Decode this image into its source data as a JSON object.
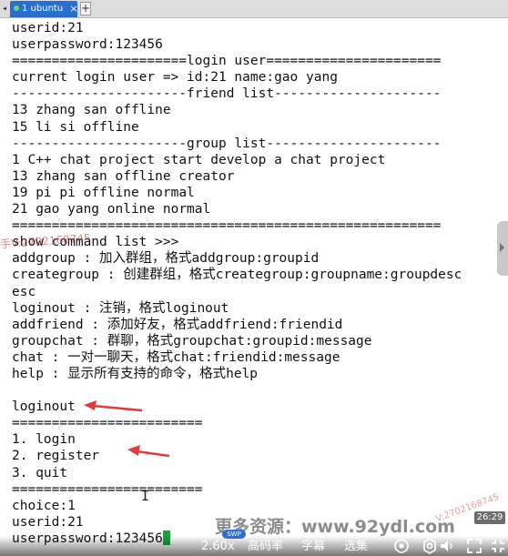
{
  "tabbar": {
    "tab_label": "1 ubuntu",
    "close_glyph": "×",
    "add_glyph": "+"
  },
  "terminal": {
    "lines": [
      "userid:21",
      "userpassword:123456",
      "======================login user======================",
      "current login user => id:21 name:gao yang",
      "----------------------friend list---------------------",
      "13 zhang san offline",
      "15 li si offline",
      "----------------------group list----------------------",
      "1 C++ chat project start develop a chat project",
      "13 zhang san offline creator",
      "19 pi pi offline normal",
      "21 gao yang online normal",
      "======================================================",
      "show command list >>>",
      "addgroup : 加入群组，格式addgroup:groupid",
      "creategroup : 创建群组，格式creategroup:groupname:groupdesc",
      "esc",
      "loginout : 注销，格式loginout",
      "addfriend : 添加好友，格式addfriend:friendid",
      "groupchat : 群聊，格式groupchat:groupid:message",
      "chat : 一对一聊天，格式chat:friendid:message",
      "help : 显示所有支持的命令，格式help",
      "",
      "loginout",
      "========================",
      "1. login",
      "2. register",
      "3. quit",
      "========================",
      "choice:1",
      "userid:21",
      "userpassword:123456"
    ]
  },
  "overlay": {
    "watermark_left": "手V:2702168745",
    "watermark_right": "V:2702168745",
    "promo_text": "更多资源：www.92ydl.com",
    "timestamp": "26:29",
    "swp_badge": "SWP"
  },
  "player": {
    "speed": "2.60x",
    "quality": "高码率",
    "subtitles": "字幕",
    "episodes": "选集"
  },
  "colors": {
    "tab_active": "#2b6ed1",
    "arrow_red": "#e23b3b",
    "cursor_green": "#1aa33a"
  }
}
